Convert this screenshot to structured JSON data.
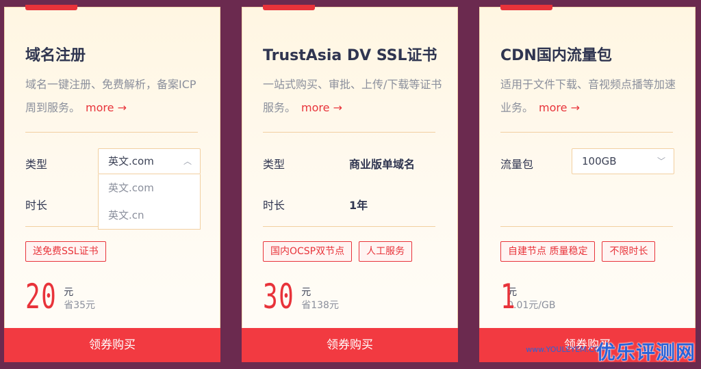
{
  "cards": [
    {
      "title": "域名注册",
      "desc": "域名一键注册、免费解析，备案ICP周到服务。",
      "more": "more",
      "row1_label": "类型",
      "select_value": "英文.com",
      "dropdown_options": [
        "英文.com",
        "英文.cn"
      ],
      "row2_label": "时长",
      "tags": [
        "送免费SSL证书"
      ],
      "price": "20",
      "unit": "元",
      "save": "省35元",
      "buy": "领券购买"
    },
    {
      "title": "TrustAsia DV SSL证书",
      "desc": "一站式购买、审批、上传/下载等证书服务。",
      "more": "more",
      "row1_label": "类型",
      "row1_value": "商业版单域名",
      "row2_label": "时长",
      "row2_value": "1年",
      "tags": [
        "国内OCSP双节点",
        "人工服务"
      ],
      "price": "30",
      "unit": "元",
      "save": "省138元",
      "buy": "领券购买"
    },
    {
      "title": "CDN国内流量包",
      "desc": "适用于文件下载、音视频点播等加速业务。",
      "more": "more",
      "row1_label": "流量包",
      "select_value": "100GB",
      "tags": [
        "自建节点 质量稳定",
        "不限时长"
      ],
      "price": "1",
      "unit": "元",
      "save": "0.01元/GB",
      "buy": "领券购买"
    }
  ],
  "watermark": "优乐评测网",
  "watermark_small": "www.YOULEYEM.COM",
  "colors": {
    "background": "#6b2a4f",
    "accent": "#e8333a",
    "card": "#fff6e2",
    "title": "#2f3550"
  }
}
